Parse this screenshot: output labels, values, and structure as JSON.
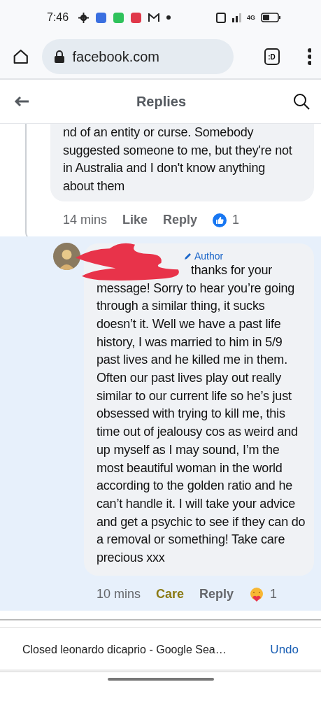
{
  "status_bar": {
    "time": "7:46",
    "network": "4G"
  },
  "browser": {
    "url": "facebook.com",
    "tab_icon": ":D"
  },
  "header": {
    "title": "Replies"
  },
  "comments": [
    {
      "kind": "cut",
      "text": "nd of an entity or curse. Somebody suggested someone to me, but they're not in Australia and I don't know anything about them",
      "time": "14 mins",
      "reaction_label": "Like",
      "reply_label": "Reply",
      "care_reaction": false,
      "reaction_count": "1",
      "highlighted": false
    },
    {
      "kind": "full",
      "badge": "Author",
      "redacted": true,
      "text": "thanks for your message! Sorry to hear you’re going through a similar thing, it sucks doesn’t it. Well we have a past life history, I was married to him in 5/9 past lives and he killed me in them. Often our past lives play out really similar to our current life so he’s just obsessed with trying to kill me, this time out of jealousy cos as weird and up myself as I may sound, I’m the most beautiful woman in the world according to the golden ratio and he can’t handle it. I will take your advice and get a psychic to see if they can do a removal or something! Take care precious xxx",
      "time": "10 mins",
      "reaction_label": "Care",
      "reply_label": "Reply",
      "care_reaction": true,
      "reaction_count": "1",
      "highlighted": true
    }
  ],
  "snackbar": {
    "message": "Closed leonardo dicaprio - Google Sea…",
    "action": "Undo"
  }
}
